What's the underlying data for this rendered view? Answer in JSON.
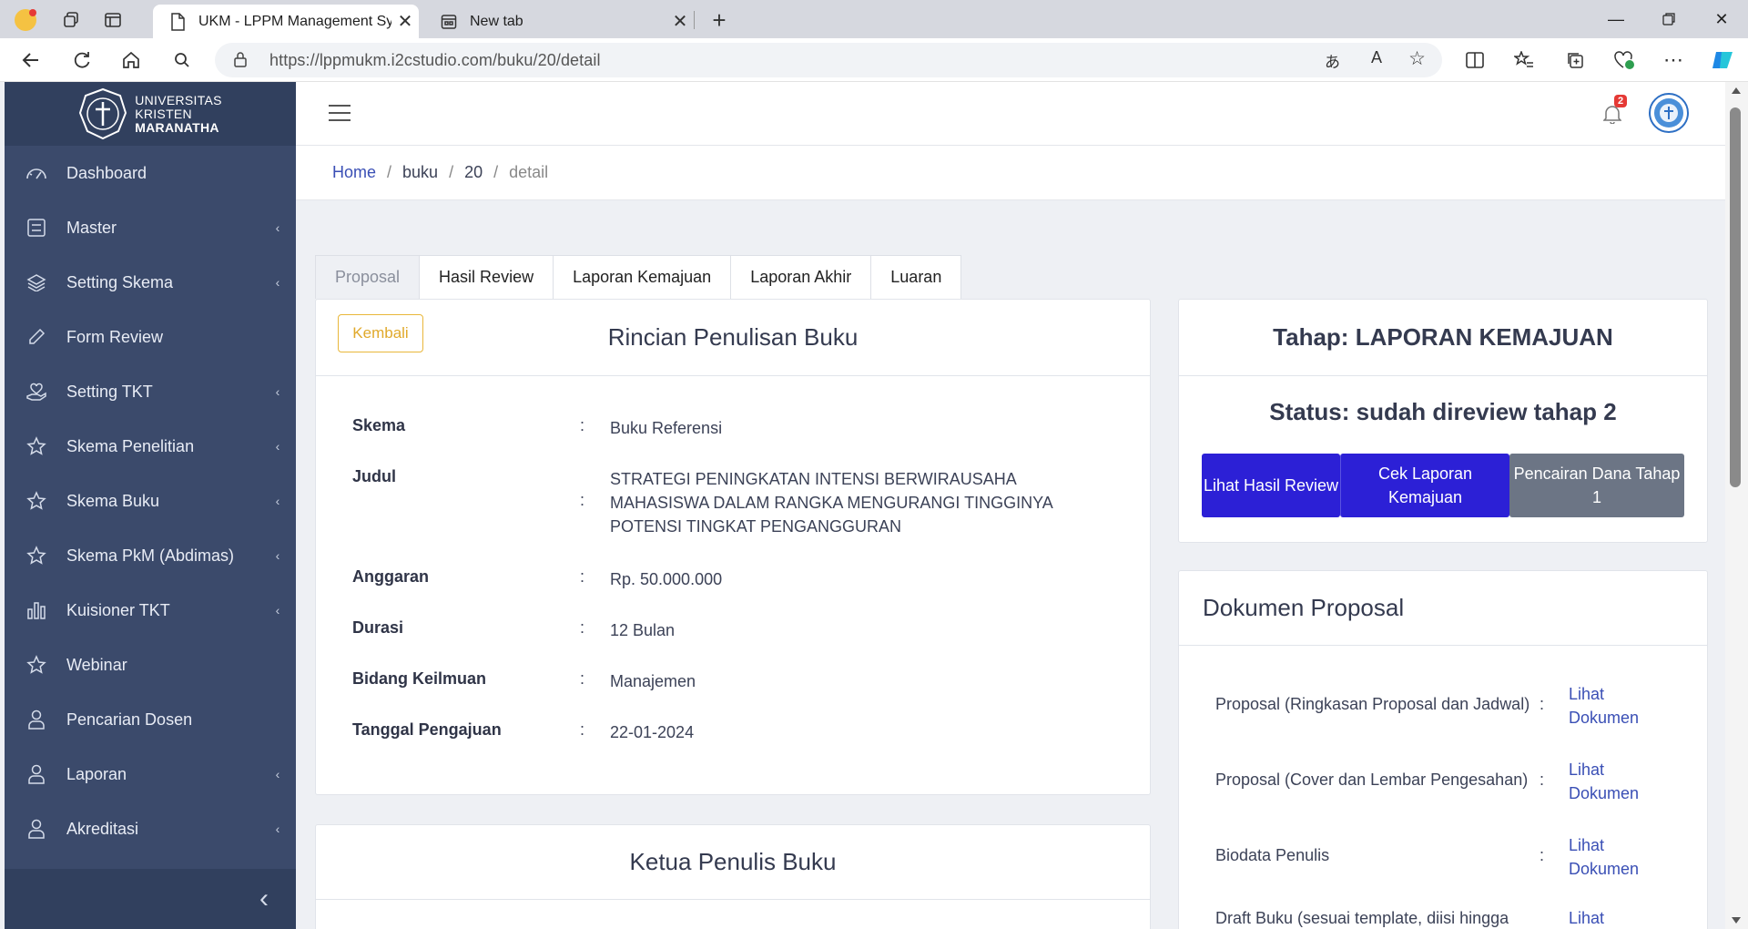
{
  "browser": {
    "active_tab_title": "UKM - LPPM Management System",
    "new_tab_title": "New tab",
    "url": "https://lppmukm.i2cstudio.com/buku/20/detail"
  },
  "sidebar": {
    "brand_line1": "UNIVERSITAS",
    "brand_line2": "KRISTEN",
    "brand_line3": "MARANATHA",
    "items": [
      {
        "label": "Dashboard",
        "icon": "gauge-icon",
        "has_children": false
      },
      {
        "label": "Master",
        "icon": "list-icon",
        "has_children": true
      },
      {
        "label": "Setting Skema",
        "icon": "layers-icon",
        "has_children": true
      },
      {
        "label": "Form Review",
        "icon": "pencil-icon",
        "has_children": false
      },
      {
        "label": "Setting TKT",
        "icon": "hand-heart-icon",
        "has_children": true
      },
      {
        "label": "Skema Penelitian",
        "icon": "star-icon",
        "has_children": true
      },
      {
        "label": "Skema Buku",
        "icon": "star-icon",
        "has_children": true
      },
      {
        "label": "Skema PkM (Abdimas)",
        "icon": "star-icon",
        "has_children": true
      },
      {
        "label": "Kuisioner TKT",
        "icon": "bar-chart-icon",
        "has_children": true
      },
      {
        "label": "Webinar",
        "icon": "star-icon",
        "has_children": false
      },
      {
        "label": "Pencarian Dosen",
        "icon": "user-icon",
        "has_children": false
      },
      {
        "label": "Laporan",
        "icon": "user-icon",
        "has_children": true
      },
      {
        "label": "Akreditasi",
        "icon": "user-icon",
        "has_children": true
      }
    ]
  },
  "topbar": {
    "notification_count": "2"
  },
  "breadcrumb": {
    "home": "Home",
    "sep": "/",
    "buku": "buku",
    "id": "20",
    "detail": "detail"
  },
  "tabs": [
    "Proposal",
    "Hasil Review",
    "Laporan Kemajuan",
    "Laporan Akhir",
    "Luaran"
  ],
  "rincian": {
    "back_label": "Kembali",
    "title": "Rincian Penulisan Buku",
    "colon": ":",
    "rows": [
      {
        "label": "Skema",
        "value": "Buku Referensi"
      },
      {
        "label": "Judul",
        "value": "STRATEGI PENINGKATAN INTENSI BERWIRAUSAHA MAHASISWA DALAM RANGKA MENGURANGI TINGGINYA POTENSI TINGKAT PENGANGGURAN"
      },
      {
        "label": "Anggaran",
        "value": "Rp. 50.000.000"
      },
      {
        "label": "Durasi",
        "value": "12 Bulan"
      },
      {
        "label": "Bidang Keilmuan",
        "value": "Manajemen"
      },
      {
        "label": "Tanggal Pengajuan",
        "value": "22-01-2024"
      }
    ]
  },
  "ketua": {
    "title": "Ketua Penulis Buku"
  },
  "tahap": {
    "title": "Tahap: LAPORAN KEMAJUAN",
    "status": "Status: sudah direview tahap 2",
    "btn_review": "Lihat Hasil Review",
    "btn_cek": "Cek Laporan Kemajuan",
    "btn_pencairan": "Pencairan Dana Tahap 1"
  },
  "dokumen": {
    "title": "Dokumen Proposal",
    "colon": ":",
    "rows": [
      {
        "label": "Proposal (Ringkasan Proposal dan Jadwal)",
        "link": "Lihat Dokumen"
      },
      {
        "label": "Proposal (Cover dan Lembar Pengesahan)",
        "link": "Lihat Dokumen"
      },
      {
        "label": "Biodata Penulis",
        "link": "Lihat Dokumen"
      },
      {
        "label": "Draft Buku (sesuai template, diisi hingga",
        "link": "Lihat"
      }
    ]
  },
  "colors": {
    "sidebar_bg": "#3b4a6b",
    "primary_button": "#2c20d6",
    "secondary_button": "#6c7585",
    "link": "#3a4fb5",
    "warning": "#e0a92b",
    "badge": "#e53935"
  }
}
